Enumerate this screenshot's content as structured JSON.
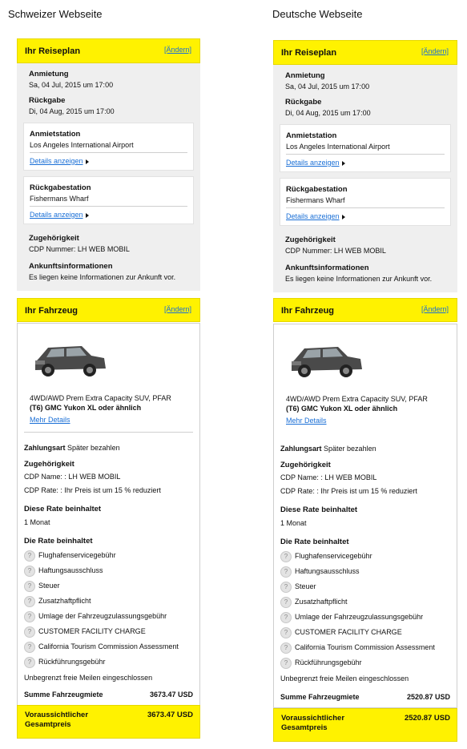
{
  "titles": {
    "left": "Schweizer Webseite",
    "right": "Deutsche Webseite"
  },
  "plan": {
    "title": "Ihr Reiseplan",
    "change": "[Ändern]",
    "pickup_label": "Anmietung",
    "pickup_date": "Sa, 04 Jul, 2015 um 17:00",
    "return_label": "Rückgabe",
    "return_date": "Di, 04 Aug, 2015 um 17:00",
    "pickup_station_label": "Anmietstation",
    "pickup_station": "Los Angeles International Airport",
    "details": "Details anzeigen",
    "return_station_label": "Rückgabestation",
    "return_station": "Fishermans Wharf",
    "affiliation_label": "Zugehörigkeit",
    "affiliation": "CDP Nummer: LH WEB MOBIL",
    "arrival_label": "Ankunftsinformationen",
    "arrival": "Es liegen keine Informationen zur Ankunft vor."
  },
  "vehicle": {
    "title": "Ihr Fahrzeug",
    "change": "[Ändern]",
    "desc1": "4WD/AWD Prem Extra Capacity SUV, PFAR",
    "desc2": "(T6) GMC Yukon XL oder ähnlich",
    "more": "Mehr Details",
    "payment_label": "Zahlungsart",
    "payment": "Später bezahlen",
    "affiliation_label": "Zugehörigkeit",
    "cdp_name": "CDP Name: : LH WEB MOBIL",
    "cdp_rate": "CDP Rate: : Ihr Preis ist um 15 % reduziert",
    "rate_includes_label": "Diese Rate beinhaltet",
    "rate_period": "1 Monat",
    "rate_items_label": "Die Rate beinhaltet",
    "items": [
      "Flughafenservicegebühr",
      "Haftungsausschluss",
      "Steuer",
      "Zusatzhaftpflicht",
      "Umlage der Fahrzeugzulassungsgebühr",
      "CUSTOMER FACILITY CHARGE",
      "California Tourism Commission Assessment",
      "Rückführungsgebühr"
    ],
    "miles": "Unbegrenzt freie Meilen eingeschlossen",
    "sum_label": "Summe Fahrzeugmiete",
    "total_label": "Voraussichtlicher Gesamtpreis"
  },
  "prices": {
    "left": {
      "sum": "3673.47 USD",
      "total": "3673.47 USD"
    },
    "right": {
      "sum": "2520.87 USD",
      "total": "2520.87 USD"
    }
  },
  "icons": {
    "info": "question-icon",
    "arrow": "triangle-right-icon",
    "car": "suv-icon"
  },
  "colors": {
    "accent": "#fff200",
    "link": "#1a6fd6",
    "panel": "#efefef"
  }
}
